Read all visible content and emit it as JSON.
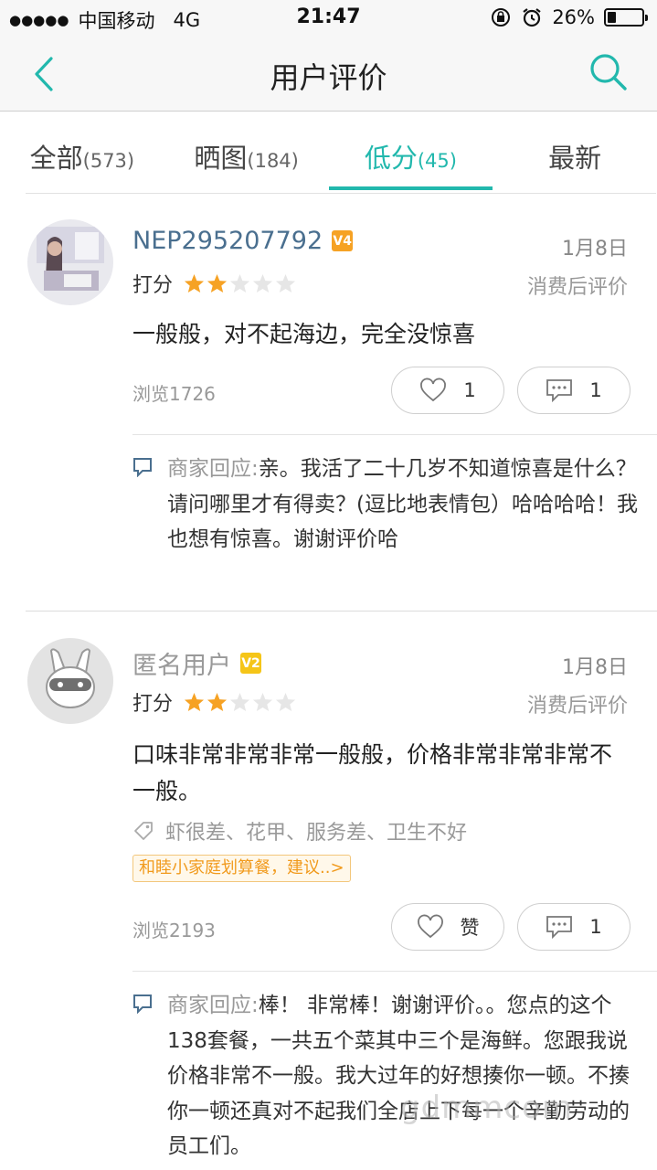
{
  "status_bar": {
    "signal": "●●●●●",
    "carrier": "中国移动",
    "network": "4G",
    "time": "21:47",
    "battery_percent": "26%",
    "battery_level": 0.26
  },
  "nav": {
    "title": "用户评价"
  },
  "tabs": [
    {
      "label": "全部",
      "count": "(573)",
      "active": false
    },
    {
      "label": "晒图",
      "count": "(184)",
      "active": false
    },
    {
      "label": "低分",
      "count": "(45)",
      "active": true
    },
    {
      "label": "最新",
      "count": "",
      "active": false
    }
  ],
  "reviews": [
    {
      "username": "NEP295207792",
      "level_badge": "V4",
      "date": "1月8日",
      "score_label": "打分",
      "rating": 2,
      "after_label": "消费后评价",
      "content": "一般般，对不起海边，完全没惊喜",
      "views": "浏览1726",
      "likes": "1",
      "comments": "1",
      "reply_label": "商家回应:",
      "reply": "亲。我活了二十几岁不知道惊喜是什么？请问哪里才有得卖？(逗比地表情包）哈哈哈哈！我也想有惊喜。谢谢评价哈"
    },
    {
      "username": "匿名用户",
      "level_badge": "V2",
      "date": "1月8日",
      "score_label": "打分",
      "rating": 2,
      "after_label": "消费后评价",
      "content": "口味非常非常非常一般般，价格非常非常非常不一般。",
      "tags": "虾很差、花甲、服务差、卫生不好",
      "package": "和睦小家庭划算餐，建议..>",
      "views": "浏览2193",
      "likes": "赞",
      "comments": "1",
      "reply_label": "商家回应:",
      "reply": "棒！ 非常棒！谢谢评价。。您点的这个138套餐，一共五个菜其中三个是海鲜。您跟我说价格非常不一般。我大过年的好想揍你一顿。不揍你一顿还真对不起我们全店上下每一个辛勤劳动的员工们。"
    }
  ],
  "colors": {
    "accent": "#22b8ad",
    "star_on": "#f6a224",
    "star_off": "#e6e6e6",
    "badge_v4": "#f6a224",
    "badge_v2": "#f5c518"
  },
  "watermark": "gdmmcom"
}
